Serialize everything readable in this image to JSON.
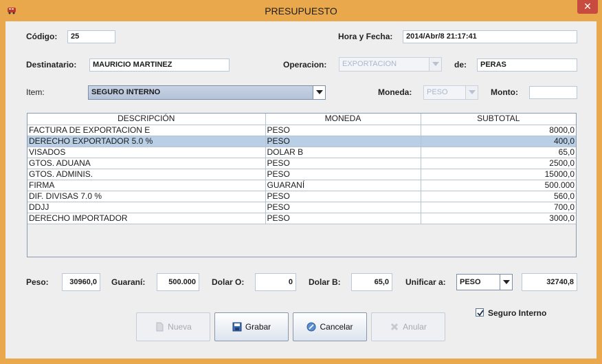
{
  "window": {
    "title": "PRESUPUESTO",
    "close_label": "✕"
  },
  "header": {
    "codigo_label": "Código:",
    "codigo_value": "25",
    "hora_label": "Hora y Fecha:",
    "hora_value": "2014/Abr/8 21:17:41",
    "destinatario_label": "Destinatario:",
    "destinatario_value": "MAURICIO MARTINEZ",
    "operacion_label": "Operacion:",
    "operacion_value": "EXPORTACION",
    "de_label": "de:",
    "de_value": "PERAS",
    "item_label": "Item:",
    "item_value": "SEGURO INTERNO",
    "moneda_label": "Moneda:",
    "moneda_value": "PESO",
    "monto_label": "Monto:",
    "monto_value": ""
  },
  "table": {
    "columns": [
      "DESCRIPCIÓN",
      "MONEDA",
      "SUBTOTAL"
    ],
    "rows": [
      [
        "FACTURA DE EXPORTACION E",
        "PESO",
        "8000,0"
      ],
      [
        "DERECHO EXPORTADOR 5.0 %",
        "PESO",
        "400,0"
      ],
      [
        "VISADOS",
        "DOLAR B",
        "65,0"
      ],
      [
        "GTOS. ADUANA",
        "PESO",
        "2500,0"
      ],
      [
        "GTOS. ADMINIS.",
        "PESO",
        "15000,0"
      ],
      [
        "FIRMA",
        "GUARANÍ",
        "500.000"
      ],
      [
        "DIF. DIVISAS 7.0 %",
        "PESO",
        "560,0"
      ],
      [
        "DDJJ",
        "PESO",
        "700,0"
      ],
      [
        "DERECHO IMPORTADOR",
        "PESO",
        "3000,0"
      ]
    ],
    "selected_row": 1
  },
  "totals": {
    "peso_label": "Peso:",
    "peso_value": "30960,0",
    "guarani_label": "Guaraní:",
    "guarani_value": "500.000",
    "dolar_o_label": "Dolar O:",
    "dolar_o_value": "0",
    "dolar_b_label": "Dolar B:",
    "dolar_b_value": "65,0",
    "unificar_label": "Unificar a:",
    "unificar_value": "PESO",
    "unificado_value": "32740,8"
  },
  "options": {
    "seguro_interno_label": "Seguro Interno",
    "seguro_interno_checked": true
  },
  "buttons": {
    "nueva": "Nueva",
    "grabar": "Grabar",
    "cancelar": "Cancelar",
    "anular": "Anular"
  },
  "colors": {
    "title_bar": "#e9a84c",
    "panel": "#eeeeee",
    "selection": "#b8cfe5",
    "close": "#c74b3f"
  },
  "icons": {
    "app": "bus-icon",
    "nueva": "document-icon",
    "grabar": "save-icon",
    "cancelar": "cancel-icon",
    "anular": "delete-icon"
  }
}
